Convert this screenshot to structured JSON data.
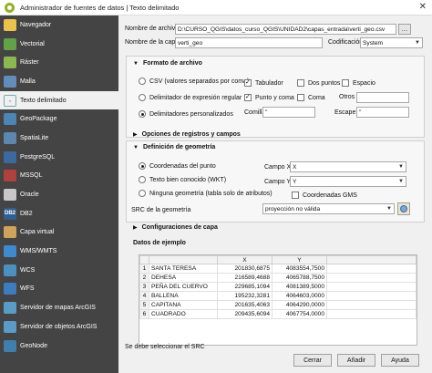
{
  "window": {
    "title": "Administrador de fuentes de datos | Texto delimitado",
    "close": "✕"
  },
  "sidebar": {
    "items": [
      {
        "label": "Navegador",
        "icon": "folder-icon",
        "glyph": ""
      },
      {
        "label": "Vectorial",
        "icon": "vector-icon",
        "glyph": "V"
      },
      {
        "label": "Ráster",
        "icon": "raster-icon",
        "glyph": "R"
      },
      {
        "label": "Malla",
        "icon": "mesh-icon",
        "glyph": "M"
      },
      {
        "label": "Texto delimitado",
        "icon": "delimited-text-icon",
        "glyph": ","
      },
      {
        "label": "GeoPackage",
        "icon": "geopackage-icon",
        "glyph": "G"
      },
      {
        "label": "SpatiaLite",
        "icon": "spatialite-icon",
        "glyph": "S"
      },
      {
        "label": "PostgreSQL",
        "icon": "postgresql-icon",
        "glyph": "P"
      },
      {
        "label": "MSSQL",
        "icon": "mssql-icon",
        "glyph": "M"
      },
      {
        "label": "Oracle",
        "icon": "oracle-icon",
        "glyph": "O"
      },
      {
        "label": "DB2",
        "icon": "db2-icon",
        "glyph": "DB2"
      },
      {
        "label": "Capa virtual",
        "icon": "virtual-layer-icon",
        "glyph": "V"
      },
      {
        "label": "WMS/WMTS",
        "icon": "wms-icon",
        "glyph": "W"
      },
      {
        "label": "WCS",
        "icon": "wcs-icon",
        "glyph": "W"
      },
      {
        "label": "WFS",
        "icon": "wfs-icon",
        "glyph": "W"
      },
      {
        "label": "Servidor de mapas ArcGIS",
        "icon": "arcgis-map-icon",
        "glyph": "A"
      },
      {
        "label": "Servidor de objetos ArcGIS",
        "icon": "arcgis-feature-icon",
        "glyph": "A"
      },
      {
        "label": "GeoNode",
        "icon": "geonode-icon",
        "glyph": "G"
      }
    ],
    "active_index": 4
  },
  "file": {
    "label": "Nombre de archivo",
    "value": "D:\\CURSO_QGIS\\datos_curso_QGIS\\UNIDAD2\\capas_entrada\\verti_geo.csv",
    "browse": "…"
  },
  "layer": {
    "label": "Nombre de la capa",
    "value": "verti_geo",
    "encoding_label": "Codificación",
    "encoding_value": "System"
  },
  "format": {
    "title": "Formato de archivo",
    "csv": "CSV (valores separados por coma)",
    "regex": "Delimitador de expresión regular",
    "custom": "Delimitadores personalizados",
    "tab": "Tabulador",
    "colon": "Dos puntos",
    "space": "Espacio",
    "semicolon": "Punto y coma",
    "comma": "Coma",
    "others_label": "Otros",
    "quote_label": "Comilla",
    "quote_value": "\"",
    "escape_label": "Escape",
    "escape_value": "\""
  },
  "records": {
    "title": "Opciones de registros y campos"
  },
  "geometry": {
    "title": "Definición de geometría",
    "point_coords": "Coordenadas del punto",
    "wkt": "Texto bien conocido (WKT)",
    "none": "Ninguna geometría (tabla solo de atributos)",
    "x_label": "Campo X",
    "x_value": "X",
    "y_label": "Campo Y",
    "y_value": "Y",
    "dms": "Coordenadas GMS",
    "crs_label": "SRC de la geometría",
    "crs_value": "proyección no válida"
  },
  "layer_config": {
    "title": "Configuraciones de capa"
  },
  "sample": {
    "title": "Datos de ejemplo",
    "columns": [
      "",
      "X",
      "Y"
    ],
    "rows": [
      [
        "1",
        "SANTA TERESA",
        "201830,6875",
        "4083554,7500"
      ],
      [
        "2",
        "DEHESA",
        "216589,4688",
        "4065788,7500"
      ],
      [
        "3",
        "PEÑA DEL CUERVO",
        "229685,1094",
        "4081389,5000"
      ],
      [
        "4",
        "BALLENA",
        "195232,3281",
        "4064603,0000"
      ],
      [
        "5",
        "CAPITANA",
        "201635,4063",
        "4064290,0000"
      ],
      [
        "6",
        "CUADRADO",
        "209435,6094",
        "4067754,0000"
      ]
    ]
  },
  "footer": {
    "status": "Se debe seleccionar el SRC",
    "close": "Cerrar",
    "add": "Añadir",
    "help": "Ayuda"
  }
}
